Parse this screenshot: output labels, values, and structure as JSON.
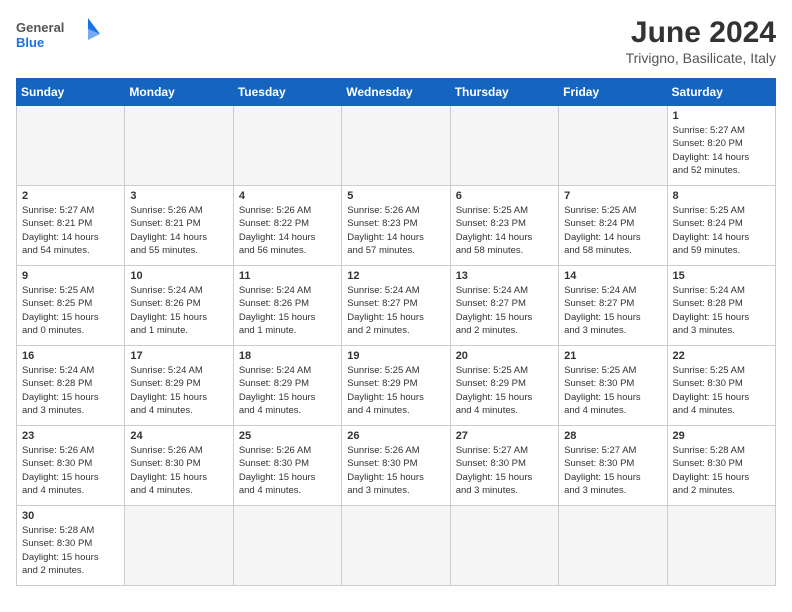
{
  "header": {
    "logo_general": "General",
    "logo_blue": "Blue",
    "title": "June 2024",
    "subtitle": "Trivigno, Basilicate, Italy"
  },
  "weekdays": [
    "Sunday",
    "Monday",
    "Tuesday",
    "Wednesday",
    "Thursday",
    "Friday",
    "Saturday"
  ],
  "weeks": [
    [
      {
        "day": "",
        "info": ""
      },
      {
        "day": "",
        "info": ""
      },
      {
        "day": "",
        "info": ""
      },
      {
        "day": "",
        "info": ""
      },
      {
        "day": "",
        "info": ""
      },
      {
        "day": "",
        "info": ""
      },
      {
        "day": "1",
        "info": "Sunrise: 5:27 AM\nSunset: 8:20 PM\nDaylight: 14 hours\nand 52 minutes."
      }
    ],
    [
      {
        "day": "2",
        "info": "Sunrise: 5:27 AM\nSunset: 8:21 PM\nDaylight: 14 hours\nand 54 minutes."
      },
      {
        "day": "3",
        "info": "Sunrise: 5:26 AM\nSunset: 8:21 PM\nDaylight: 14 hours\nand 55 minutes."
      },
      {
        "day": "4",
        "info": "Sunrise: 5:26 AM\nSunset: 8:22 PM\nDaylight: 14 hours\nand 56 minutes."
      },
      {
        "day": "5",
        "info": "Sunrise: 5:26 AM\nSunset: 8:23 PM\nDaylight: 14 hours\nand 57 minutes."
      },
      {
        "day": "6",
        "info": "Sunrise: 5:25 AM\nSunset: 8:23 PM\nDaylight: 14 hours\nand 58 minutes."
      },
      {
        "day": "7",
        "info": "Sunrise: 5:25 AM\nSunset: 8:24 PM\nDaylight: 14 hours\nand 58 minutes."
      },
      {
        "day": "8",
        "info": "Sunrise: 5:25 AM\nSunset: 8:24 PM\nDaylight: 14 hours\nand 59 minutes."
      }
    ],
    [
      {
        "day": "9",
        "info": "Sunrise: 5:25 AM\nSunset: 8:25 PM\nDaylight: 15 hours\nand 0 minutes."
      },
      {
        "day": "10",
        "info": "Sunrise: 5:24 AM\nSunset: 8:26 PM\nDaylight: 15 hours\nand 1 minute."
      },
      {
        "day": "11",
        "info": "Sunrise: 5:24 AM\nSunset: 8:26 PM\nDaylight: 15 hours\nand 1 minute."
      },
      {
        "day": "12",
        "info": "Sunrise: 5:24 AM\nSunset: 8:27 PM\nDaylight: 15 hours\nand 2 minutes."
      },
      {
        "day": "13",
        "info": "Sunrise: 5:24 AM\nSunset: 8:27 PM\nDaylight: 15 hours\nand 2 minutes."
      },
      {
        "day": "14",
        "info": "Sunrise: 5:24 AM\nSunset: 8:27 PM\nDaylight: 15 hours\nand 3 minutes."
      },
      {
        "day": "15",
        "info": "Sunrise: 5:24 AM\nSunset: 8:28 PM\nDaylight: 15 hours\nand 3 minutes."
      }
    ],
    [
      {
        "day": "16",
        "info": "Sunrise: 5:24 AM\nSunset: 8:28 PM\nDaylight: 15 hours\nand 3 minutes."
      },
      {
        "day": "17",
        "info": "Sunrise: 5:24 AM\nSunset: 8:29 PM\nDaylight: 15 hours\nand 4 minutes."
      },
      {
        "day": "18",
        "info": "Sunrise: 5:24 AM\nSunset: 8:29 PM\nDaylight: 15 hours\nand 4 minutes."
      },
      {
        "day": "19",
        "info": "Sunrise: 5:25 AM\nSunset: 8:29 PM\nDaylight: 15 hours\nand 4 minutes."
      },
      {
        "day": "20",
        "info": "Sunrise: 5:25 AM\nSunset: 8:29 PM\nDaylight: 15 hours\nand 4 minutes."
      },
      {
        "day": "21",
        "info": "Sunrise: 5:25 AM\nSunset: 8:30 PM\nDaylight: 15 hours\nand 4 minutes."
      },
      {
        "day": "22",
        "info": "Sunrise: 5:25 AM\nSunset: 8:30 PM\nDaylight: 15 hours\nand 4 minutes."
      }
    ],
    [
      {
        "day": "23",
        "info": "Sunrise: 5:26 AM\nSunset: 8:30 PM\nDaylight: 15 hours\nand 4 minutes."
      },
      {
        "day": "24",
        "info": "Sunrise: 5:26 AM\nSunset: 8:30 PM\nDaylight: 15 hours\nand 4 minutes."
      },
      {
        "day": "25",
        "info": "Sunrise: 5:26 AM\nSunset: 8:30 PM\nDaylight: 15 hours\nand 4 minutes."
      },
      {
        "day": "26",
        "info": "Sunrise: 5:26 AM\nSunset: 8:30 PM\nDaylight: 15 hours\nand 3 minutes."
      },
      {
        "day": "27",
        "info": "Sunrise: 5:27 AM\nSunset: 8:30 PM\nDaylight: 15 hours\nand 3 minutes."
      },
      {
        "day": "28",
        "info": "Sunrise: 5:27 AM\nSunset: 8:30 PM\nDaylight: 15 hours\nand 3 minutes."
      },
      {
        "day": "29",
        "info": "Sunrise: 5:28 AM\nSunset: 8:30 PM\nDaylight: 15 hours\nand 2 minutes."
      }
    ],
    [
      {
        "day": "30",
        "info": "Sunrise: 5:28 AM\nSunset: 8:30 PM\nDaylight: 15 hours\nand 2 minutes."
      },
      {
        "day": "",
        "info": ""
      },
      {
        "day": "",
        "info": ""
      },
      {
        "day": "",
        "info": ""
      },
      {
        "day": "",
        "info": ""
      },
      {
        "day": "",
        "info": ""
      },
      {
        "day": "",
        "info": ""
      }
    ]
  ]
}
